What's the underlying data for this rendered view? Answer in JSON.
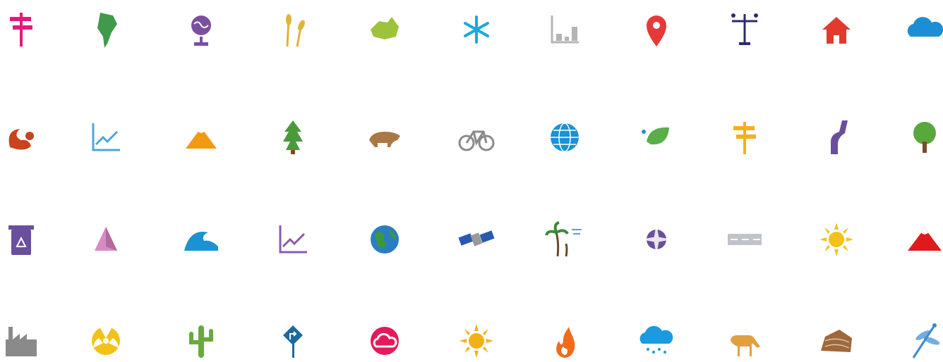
{
  "icons": [
    {
      "name": "signpost-icon",
      "color": "#e6197a"
    },
    {
      "name": "south-america-icon",
      "color": "#3f9a4a"
    },
    {
      "name": "globe-stand-icon",
      "color": "#7a4fa0"
    },
    {
      "name": "wheat-icon",
      "color": "#e0b33a"
    },
    {
      "name": "australia-icon",
      "color": "#9cc43a"
    },
    {
      "name": "snowflake-icon",
      "color": "#1ba8e0"
    },
    {
      "name": "bar-chart-icon",
      "color": "#b5b5b5"
    },
    {
      "name": "map-pin-icon",
      "color": "#e63a3a"
    },
    {
      "name": "weather-vane-icon",
      "color": "#2c2a6e"
    },
    {
      "name": "house-icon",
      "color": "#e23a2e"
    },
    {
      "name": "cloud-icon",
      "color": "#1a8fd6"
    },
    {
      "name": "squirrel-icon",
      "color": "#c8441e"
    },
    {
      "name": "line-chart-icon",
      "color": "#4aa7dc"
    },
    {
      "name": "mountain-icon",
      "color": "#f29a12"
    },
    {
      "name": "pine-tree-icon",
      "color": "#4a9a3a"
    },
    {
      "name": "bear-icon",
      "color": "#a97845"
    },
    {
      "name": "bicycle-icon",
      "color": "#8a8a8a"
    },
    {
      "name": "globe-icon",
      "color": "#1a92d4"
    },
    {
      "name": "leaf-droplet-icon",
      "color": "#5aae4a"
    },
    {
      "name": "direction-sign-icon",
      "color": "#f2b11a"
    },
    {
      "name": "road-icon",
      "color": "#6a4f9e"
    },
    {
      "name": "deciduous-tree-icon",
      "color": "#59a83c"
    },
    {
      "name": "recycle-bin-icon",
      "color": "#6a4f9e"
    },
    {
      "name": "pyramid-icon",
      "color": "#d98ac4"
    },
    {
      "name": "wave-icon",
      "color": "#1a92d4"
    },
    {
      "name": "trend-chart-icon",
      "color": "#8a5ab0"
    },
    {
      "name": "earth-icon",
      "color": "#2a7ec0"
    },
    {
      "name": "satellite-icon",
      "color": "#2a5ab0"
    },
    {
      "name": "palm-trees-wind-icon",
      "color": "#3a8a3a"
    },
    {
      "name": "compass-rose-icon",
      "color": "#6a4f9e"
    },
    {
      "name": "highway-icon",
      "color": "#c0c4c8"
    },
    {
      "name": "sun-icon",
      "color": "#f2c21a"
    },
    {
      "name": "red-mountain-icon",
      "color": "#e01a1a"
    },
    {
      "name": "factory-icon",
      "color": "#8a8a8a"
    },
    {
      "name": "radiation-icon",
      "color": "#f2c21a"
    },
    {
      "name": "cactus-icon",
      "color": "#6aaa3a"
    },
    {
      "name": "turn-sign-icon",
      "color": "#1a6aa0"
    },
    {
      "name": "cloud-circle-icon",
      "color": "#e6195a"
    },
    {
      "name": "sun-rays-icon",
      "color": "#f2b11a"
    },
    {
      "name": "fire-icon",
      "color": "#f26a1a"
    },
    {
      "name": "rain-cloud-icon",
      "color": "#1a9ae0"
    },
    {
      "name": "deer-icon",
      "color": "#e0a040"
    },
    {
      "name": "rock-icon",
      "color": "#a0683a"
    },
    {
      "name": "dragonfly-icon",
      "color": "#3a8ad0"
    }
  ]
}
